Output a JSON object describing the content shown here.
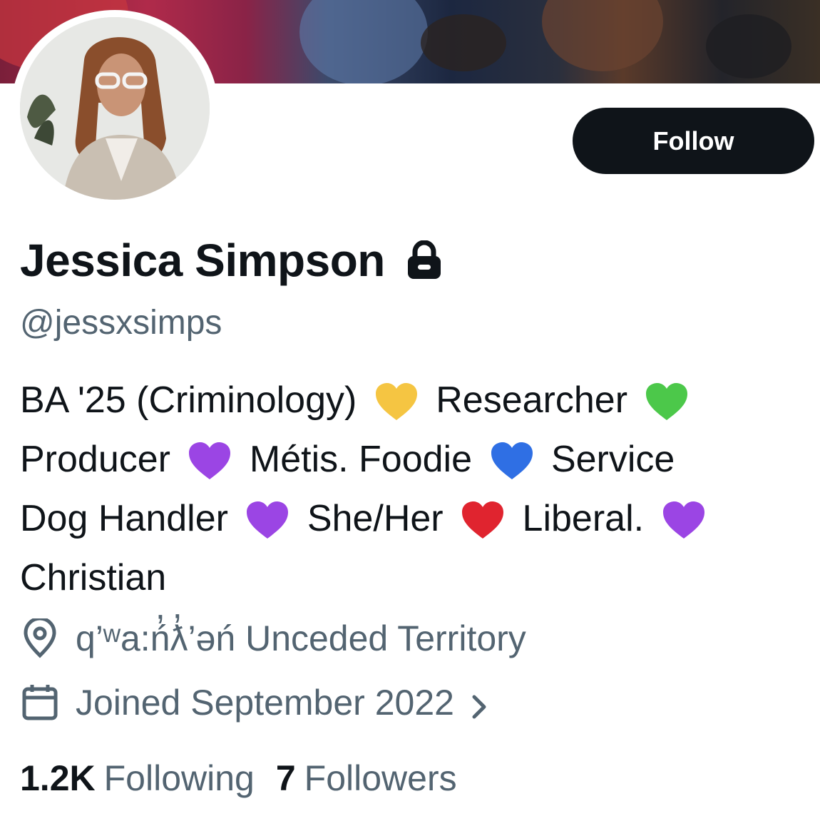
{
  "profile": {
    "display_name": "Jessica Simpson",
    "handle": "@jessxsimps",
    "protected_icon": "lock-icon",
    "follow_label": "Follow",
    "bio_lines": [
      {
        "parts": [
          "BA '25 (Criminology)",
          "yellow-heart",
          "Researcher",
          "green-heart"
        ]
      },
      {
        "parts": [
          "Producer",
          "purple-heart",
          "Métis. Foodie",
          "blue-heart",
          "Service"
        ]
      },
      {
        "parts": [
          "Dog Handler",
          "purple-heart",
          "She/Her",
          "red-heart",
          "Liberal.",
          "purple-heart"
        ]
      },
      {
        "parts": [
          "Christian"
        ]
      }
    ],
    "location": "q’ʷa:ń̓ƛ̓’əń Unceded Territory",
    "location_icon": "location-pin-icon",
    "joined": "Joined September 2022",
    "joined_icon": "calendar-icon",
    "following_count": "1.2K",
    "following_label": "Following",
    "followers_count": "7",
    "followers_label": "Followers"
  },
  "colors": {
    "text_primary": "#0f1419",
    "text_secondary": "#536471",
    "button_bg": "#0f1419",
    "button_text": "#ffffff",
    "yellow-heart": "#f5c542",
    "green-heart": "#4cc84a",
    "purple-heart": "#9b45e4",
    "blue-heart": "#2f6fe4",
    "red-heart": "#e0242f"
  }
}
